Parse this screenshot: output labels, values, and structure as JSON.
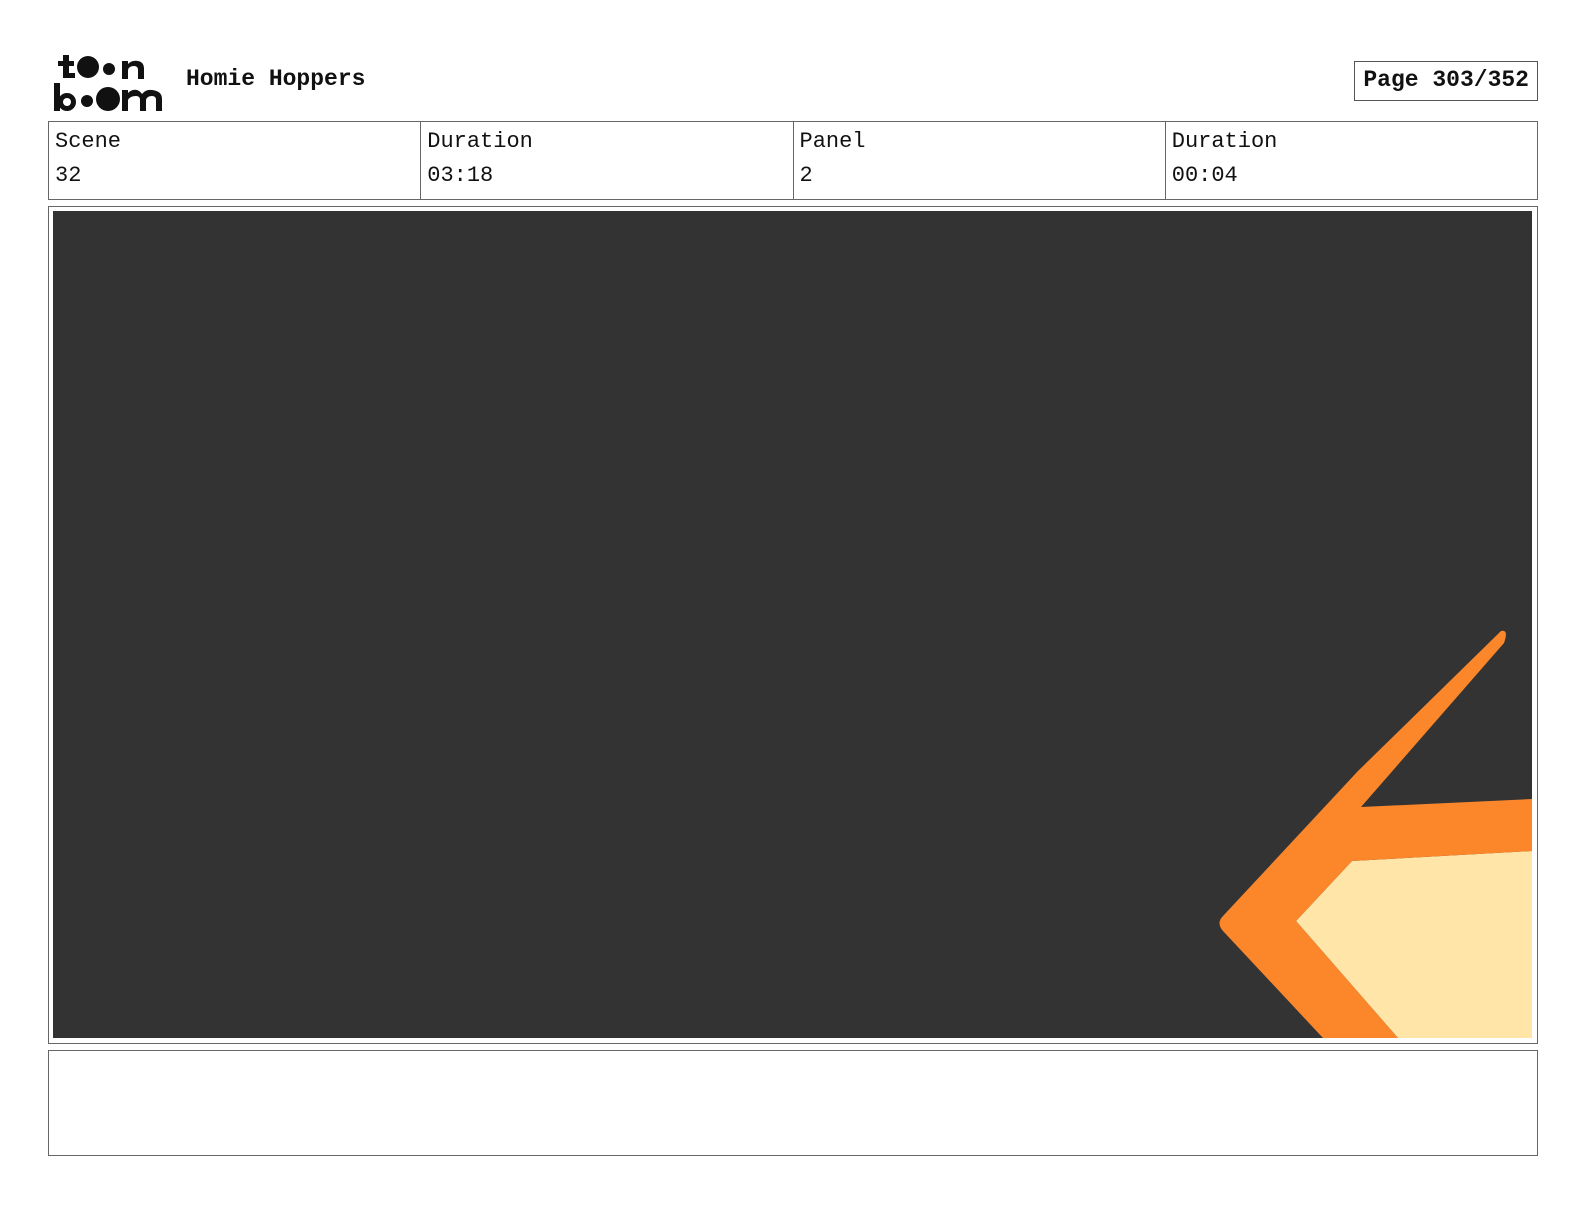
{
  "header": {
    "logo_alt": "toon boom",
    "project_title": "Homie Hoppers",
    "page_label": "Page 303/352"
  },
  "info": {
    "scene_label": "Scene",
    "scene_value": "32",
    "scene_duration_label": "Duration",
    "scene_duration_value": "03:18",
    "panel_label": "Panel",
    "panel_value": "2",
    "panel_duration_label": "Duration",
    "panel_duration_value": "00:04"
  },
  "panel": {
    "background_color": "#333333",
    "stroke_color": "#fc872b",
    "fill_color": "#ffe6a8"
  },
  "notes": {
    "text": ""
  }
}
